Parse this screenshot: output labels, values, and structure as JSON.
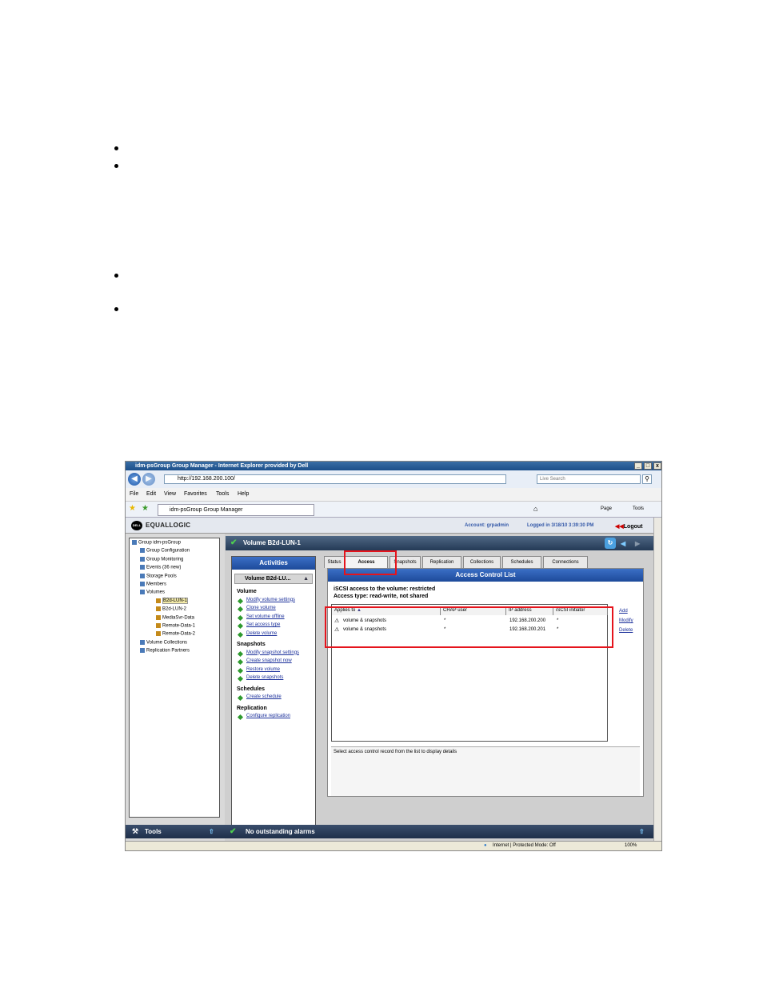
{
  "window": {
    "title": "idm-psGroup Group Manager - Internet Explorer provided by Dell",
    "url": "http://192.168.200.100/",
    "search_placeholder": "Live Search",
    "tab_title": "idm-psGroup Group Manager",
    "controls": [
      "_",
      "□",
      "x"
    ]
  },
  "menu": [
    "File",
    "Edit",
    "View",
    "Favorites",
    "Tools",
    "Help"
  ],
  "ie_toolbar": {
    "page": "Page",
    "tools": "Tools"
  },
  "app": {
    "brand": "EQUALLOGIC",
    "dell_badge": "DELL",
    "account": "Account: grpadmin",
    "logged_in": "Logged in 3/18/10 3:39:30 PM",
    "logout": "Logout"
  },
  "tree": [
    {
      "label": "Group idm-psGroup",
      "level": 0
    },
    {
      "label": "Group Configuration",
      "level": 1
    },
    {
      "label": "Group Monitoring",
      "level": 1
    },
    {
      "label": "Events (36 new)",
      "level": 1
    },
    {
      "label": "Storage Pools",
      "level": 1
    },
    {
      "label": "Members",
      "level": 1
    },
    {
      "label": "Volumes",
      "level": 1
    },
    {
      "label": "B2d-LUN-1",
      "level": 2
    },
    {
      "label": "B2d-LUN-2",
      "level": 2
    },
    {
      "label": "MediaSvr-Data",
      "level": 2
    },
    {
      "label": "Remote-Data-1",
      "level": 2
    },
    {
      "label": "Remote-Data-2",
      "level": 2
    },
    {
      "label": "Volume Collections",
      "level": 1
    },
    {
      "label": "Replication Partners",
      "level": 1
    }
  ],
  "volume_header": "Volume B2d-LUN-1",
  "activities": {
    "title": "Activities",
    "selector": "Volume B2d-LU...",
    "sections": [
      {
        "title": "Volume",
        "links": [
          "Modify volume settings",
          "Clone volume",
          "Set volume offline",
          "Set access type",
          "Delete volume"
        ]
      },
      {
        "title": "Snapshots",
        "links": [
          "Modify snapshot settings",
          "Create snapshot now",
          "Restore volume",
          "Delete snapshots"
        ]
      },
      {
        "title": "Schedules",
        "links": [
          "Create schedule"
        ]
      },
      {
        "title": "Replication",
        "links": [
          "Configure replication"
        ]
      }
    ]
  },
  "tabs": [
    "Status",
    "Access",
    "Snapshots",
    "Replication",
    "Collections",
    "Schedules",
    "Connections"
  ],
  "acl": {
    "title": "Access Control List",
    "line1": "iSCSI access to the volume: restricted",
    "line2": "Access type: read-write, not shared",
    "columns": [
      "Applies to",
      "CHAP user",
      "IP address",
      "iSCSI initiator"
    ],
    "rows": [
      {
        "applies": "volume & snapshots",
        "chap": "*",
        "ip": "192.168.200.200",
        "initiator": "*"
      },
      {
        "applies": "volume & snapshots",
        "chap": "*",
        "ip": "192.168.200.201",
        "initiator": "*"
      }
    ],
    "actions": [
      "Add",
      "Modify",
      "Delete"
    ],
    "detail": "Select access control record from the list to display details"
  },
  "bottom": {
    "tools": "Tools",
    "alarms": "No outstanding alarms"
  },
  "status": {
    "zone": "Internet | Protected Mode: Off",
    "zoom": "100%"
  }
}
